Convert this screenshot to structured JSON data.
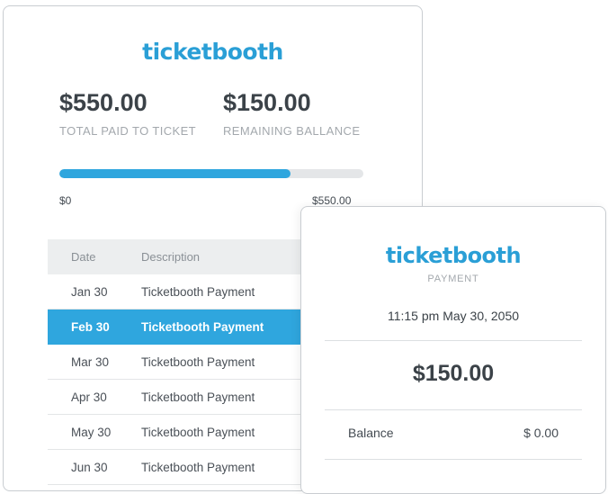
{
  "brand": {
    "name": "ticketbooth",
    "color": "#2a9fd6"
  },
  "summary": {
    "paid_amount": "$550.00",
    "paid_label": "TOTAL PAID TO TICKET",
    "remaining_amount": "$150.00",
    "remaining_label": "REMAINING BALLANCE"
  },
  "progress": {
    "fraction": 0.76,
    "min_label": "$0",
    "max_label": "$550.00"
  },
  "table": {
    "columns": [
      "Date",
      "Description"
    ],
    "rows": [
      {
        "date": "Jan 30",
        "description": "Ticketbooth Payment",
        "selected": false
      },
      {
        "date": "Feb 30",
        "description": "Ticketbooth Payment",
        "selected": true
      },
      {
        "date": "Mar 30",
        "description": "Ticketbooth Payment",
        "selected": false
      },
      {
        "date": "Apr 30",
        "description": "Ticketbooth Payment",
        "selected": false
      },
      {
        "date": "May 30",
        "description": "Ticketbooth Payment",
        "selected": false
      },
      {
        "date": "Jun 30",
        "description": "Ticketbooth Payment",
        "selected": false
      }
    ]
  },
  "receipt": {
    "brand": "ticketbooth",
    "subtitle": "PAYMENT",
    "datetime": "11:15 pm  May 30, 2050",
    "amount": "$150.00",
    "line_label": "Balance",
    "line_value": "$ 0.00"
  },
  "colors": {
    "accent": "#2fa6de",
    "track": "#e4e6e8",
    "header_bg": "#eceeef"
  }
}
